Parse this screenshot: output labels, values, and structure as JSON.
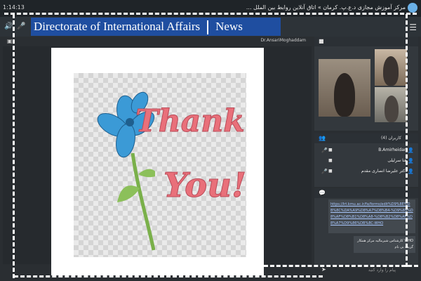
{
  "titlebar": {
    "timer": "1:14:13",
    "title": "... مرکز آموزش مجازی د.ع.پ. کرمان » اتاق آنلاین روابط بین الملل"
  },
  "banner": {
    "left": "Directorate of International Affairs",
    "right": "News"
  },
  "presentation": {
    "presenter": "Dr.AnsariMoghaddam",
    "slide_text_1": "Thank",
    "slide_text_2": "You!"
  },
  "users": {
    "count": "کاربران (4)",
    "list": [
      {
        "name": "B.Amirheidari"
      },
      {
        "name": "هنا سرلیلی"
      },
      {
        "name": "دکتر علیرضا انصاری مقدم"
      }
    ]
  },
  "chat": {
    "link": "https://lrt.kmu.ac.ir/fa/forms/edit%D9%8E%DB%8C%DA%A9%D8%A7%D8%B4-%D9%85%D8%AF%D8%B1%D8%A8-%D8%B2%D8%AF%D8%A7%D9%86%DB%8C-WHO",
    "message": "کارشناس شیرمالیه مرکز همکار WHO",
    "message2": "گزیده بی نام",
    "placeholder": "پیام را وارد کنید"
  },
  "colors": {
    "banner_bg": "#1f4ea0",
    "slide_text": "#e9707a",
    "flower": "#3b9ad6"
  }
}
